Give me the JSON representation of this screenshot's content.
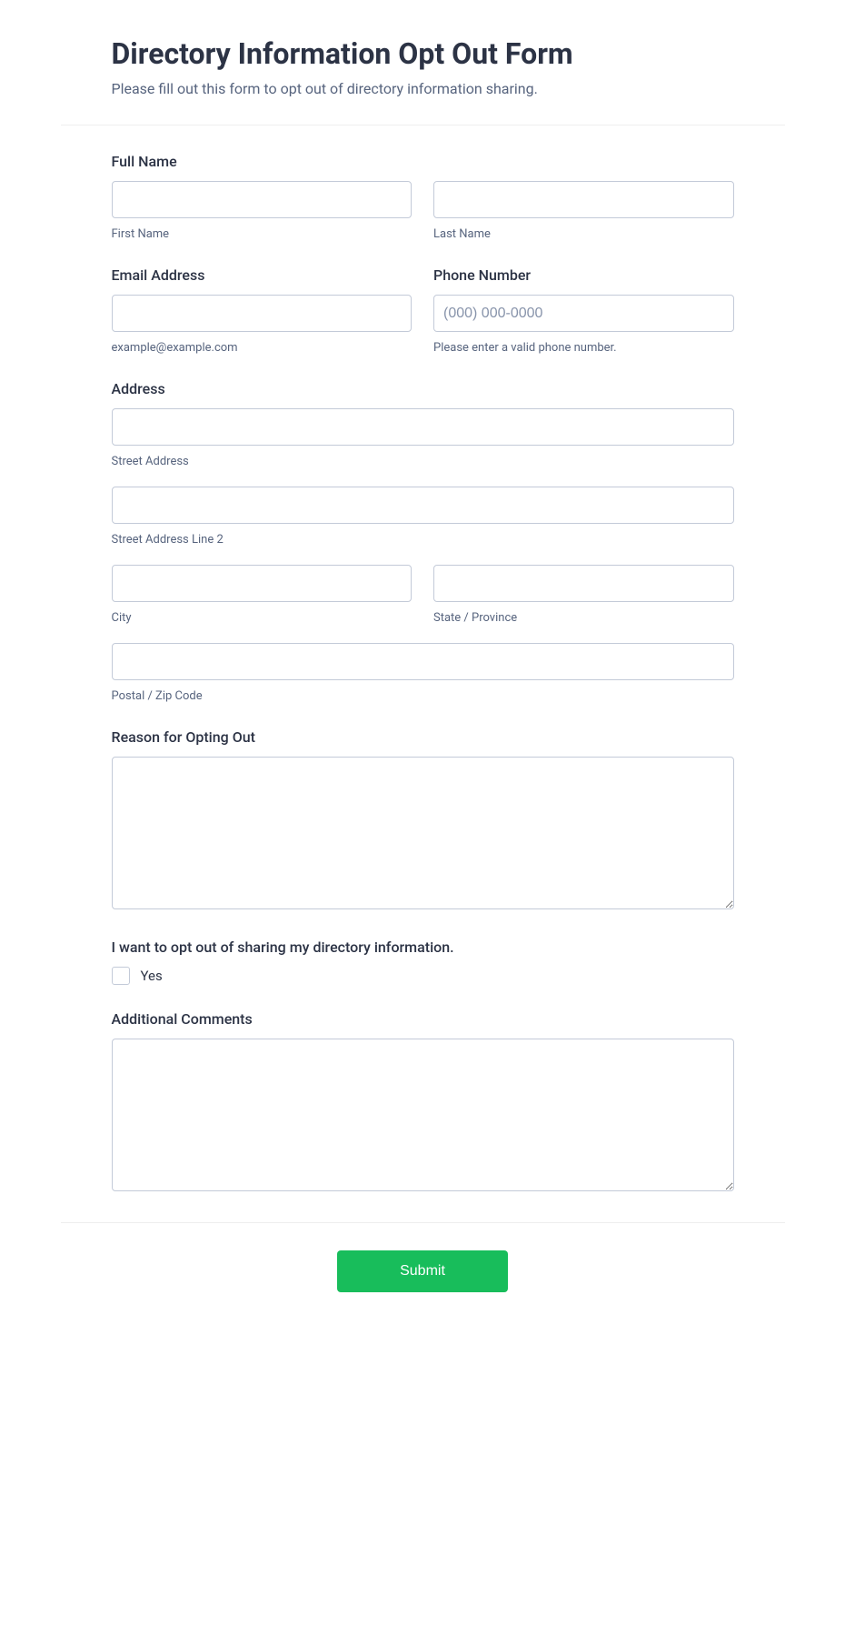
{
  "header": {
    "title": "Directory Information Opt Out Form",
    "subtitle": "Please fill out this form to opt out of directory information sharing."
  },
  "fullName": {
    "label": "Full Name",
    "firstSub": "First Name",
    "lastSub": "Last Name"
  },
  "email": {
    "label": "Email Address",
    "sub": "example@example.com"
  },
  "phone": {
    "label": "Phone Number",
    "placeholder": "(000) 000-0000",
    "sub": "Please enter a valid phone number."
  },
  "address": {
    "label": "Address",
    "streetSub": "Street Address",
    "street2Sub": "Street Address Line 2",
    "citySub": "City",
    "stateSub": "State / Province",
    "postalSub": "Postal / Zip Code"
  },
  "reason": {
    "label": "Reason for Opting Out"
  },
  "optOut": {
    "label": "I want to opt out of sharing my directory information.",
    "optionYes": "Yes"
  },
  "comments": {
    "label": "Additional Comments"
  },
  "submit": {
    "label": "Submit"
  }
}
